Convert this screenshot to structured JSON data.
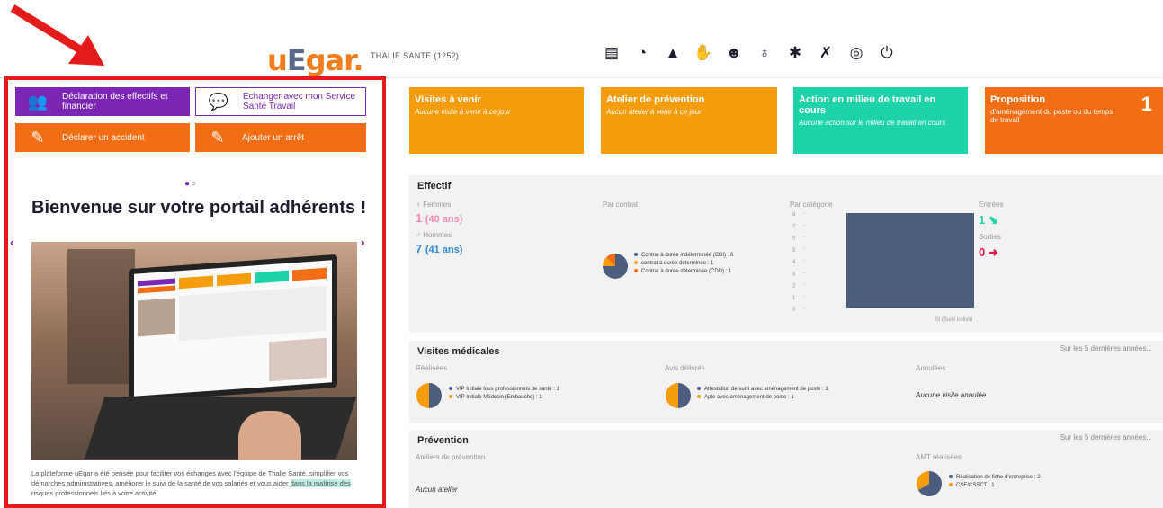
{
  "header": {
    "logo_u": "u",
    "logo_e": "E",
    "logo_rest": "gar.",
    "company": "THALIE SANTE (1252)",
    "icons": [
      "list-icon",
      "history-icon",
      "cone-icon",
      "hand-icon",
      "group-icon",
      "stethoscope-icon",
      "gear-icon",
      "no-wand-icon",
      "user-icon",
      "power-icon"
    ]
  },
  "actions": {
    "declaration": "Déclaration des effectifs et financier",
    "echanger": "Echanger avec mon Service Santé Travail",
    "accident": "Déclarer un accident",
    "arret": "Ajouter un arrêt"
  },
  "carousel": {
    "dots": "●○",
    "prev": "‹",
    "next": "›",
    "title": "Bienvenue sur votre portail adhérents !",
    "desc_1": "La plateforme uEgar a été pensée pour faciliter vos échanges avec l'équipe de Thalie Santé, simplifier vos démarches administratives, améliorer le suivi de la santé de vos salariés et vous aider ",
    "desc_hl": "dans la maîtrise des",
    "desc_2": " risques professionnels liés à votre activité."
  },
  "tiles": [
    {
      "title": "Visites à venir",
      "sub": "Aucune visite à venir à ce jour",
      "color": "#f59d0c"
    },
    {
      "title": "Atelier de prévention",
      "sub": "Aucun atelier à venir à ce jour",
      "color": "#f59d0c"
    },
    {
      "title": "Action en milieu de travail en cours",
      "sub": "Aucune action sur le milieu de travail en cours",
      "color": "#1ed3a9"
    },
    {
      "title": "Proposition",
      "sub": "d'aménagement du poste ou du temps de travail",
      "count": "1",
      "color": "#f26d13"
    }
  ],
  "effectif": {
    "title": "Effectif",
    "femmes_label": "♀ Femmes",
    "femmes_count": "1",
    "femmes_age": "(40 ans)",
    "hommes_label": "♂ Hommes",
    "hommes_count": "7",
    "hommes_age": "(41 ans)",
    "par_contrat": "Par contrat",
    "contrats": [
      {
        "label": "Contrat à durée indéterminée (CDI) : 6",
        "value": 6,
        "color": "#4c5d7d"
      },
      {
        "label": "contrat à durée déterminée : 1",
        "value": 1,
        "color": "#f59d0c"
      },
      {
        "label": "Contrat à durée déterminée (CDD) : 1",
        "value": 1,
        "color": "#f26d13"
      }
    ],
    "par_categorie": "Par catégorie",
    "entrees_label": "Entrées",
    "entrees": "1",
    "sorties_label": "Sorties",
    "sorties": "0"
  },
  "chart_data": {
    "type": "bar",
    "categories": [
      "SI (Suivi Individ"
    ],
    "values": [
      8
    ],
    "ylim": [
      0,
      8
    ],
    "yticks": [
      "8",
      "7",
      "6",
      "5",
      "4",
      "3",
      "2",
      "1",
      "0"
    ],
    "color": "#4c5d7d"
  },
  "visites": {
    "title": "Visites médicales",
    "more": "Sur les 5 dernières années...",
    "realisees": "Réalisées",
    "realisees_items": [
      {
        "label": "VIP Initiale tous professionnels de santé : 1",
        "color": "#4c5d7d"
      },
      {
        "label": "VIP Initiale Médecin (Embauche) : 1",
        "color": "#f59d0c"
      }
    ],
    "avis": "Avis délivrés",
    "avis_items": [
      {
        "label": "Attestation de suivi avec aménagement de poste : 1",
        "color": "#4c5d7d"
      },
      {
        "label": "Apte avec aménagement de poste : 1",
        "color": "#f59d0c"
      }
    ],
    "annulees": "Annulées",
    "annulees_none": "Aucune visite annulée"
  },
  "prevention": {
    "title": "Prévention",
    "more": "Sur les 5 dernières années...",
    "ateliers": "Ateliers de prévention",
    "ateliers_none": "Aucun atelier",
    "amt": "AMT réalisées",
    "amt_items": [
      {
        "label": "Réalisation de fiche d'entreprise : 2",
        "color": "#4c5d7d"
      },
      {
        "label": "CSE/CSSCT : 1",
        "color": "#f59d0c"
      }
    ]
  }
}
